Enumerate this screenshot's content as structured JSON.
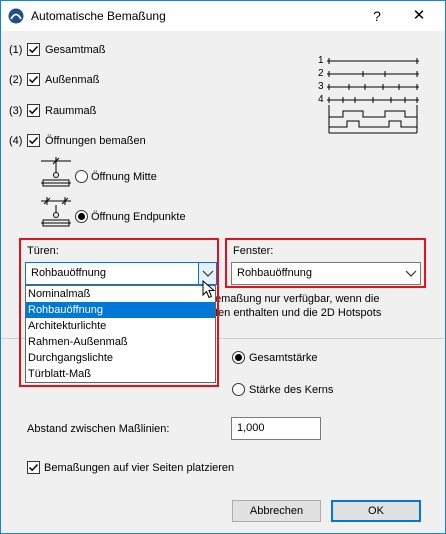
{
  "window": {
    "title": "Automatische Bemaßung",
    "help": "?",
    "close": "✕"
  },
  "options": {
    "total": {
      "num": "(1)",
      "label": "Gesamtmaß",
      "checked": true
    },
    "outer": {
      "num": "(2)",
      "label": "Außenmaß",
      "checked": true
    },
    "room": {
      "num": "(3)",
      "label": "Raummaß",
      "checked": true
    },
    "openings": {
      "num": "(4)",
      "label": "Öffnungen bemaßen",
      "checked": true
    }
  },
  "preview_numbers": [
    "1",
    "2",
    "3",
    "4"
  ],
  "opening_mode": {
    "center_label": "Öffnung Mitte",
    "endpoints_label": "Öffnung Endpunkte",
    "selected": "endpoints"
  },
  "doors": {
    "label": "Türen:",
    "value": "Rohbauöffnung",
    "options": [
      "Nominalmaß",
      "Rohbauöffnung",
      "Architekturlichte",
      "Rahmen-Außenmaß",
      "Durchgangslichte",
      "Türblatt-Maß"
    ],
    "selected_index": 1
  },
  "windows": {
    "label": "Fenster:",
    "value": "Rohbauöffnung"
  },
  "note": {
    "line1": "emaßung nur verfügbar, wenn die",
    "line2": "ten enthalten und die 2D Hotspots"
  },
  "thickness": {
    "total_label": "Gesamtstärke",
    "core_label": "Stärke des Kerns",
    "selected": "total"
  },
  "spacing": {
    "label": "Abstand zwischen Maßlinien:",
    "value": "1,000"
  },
  "four_sides": {
    "label": "Bemaßungen auf vier Seiten platzieren",
    "checked": true
  },
  "buttons": {
    "cancel": "Abbrechen",
    "ok": "OK"
  }
}
